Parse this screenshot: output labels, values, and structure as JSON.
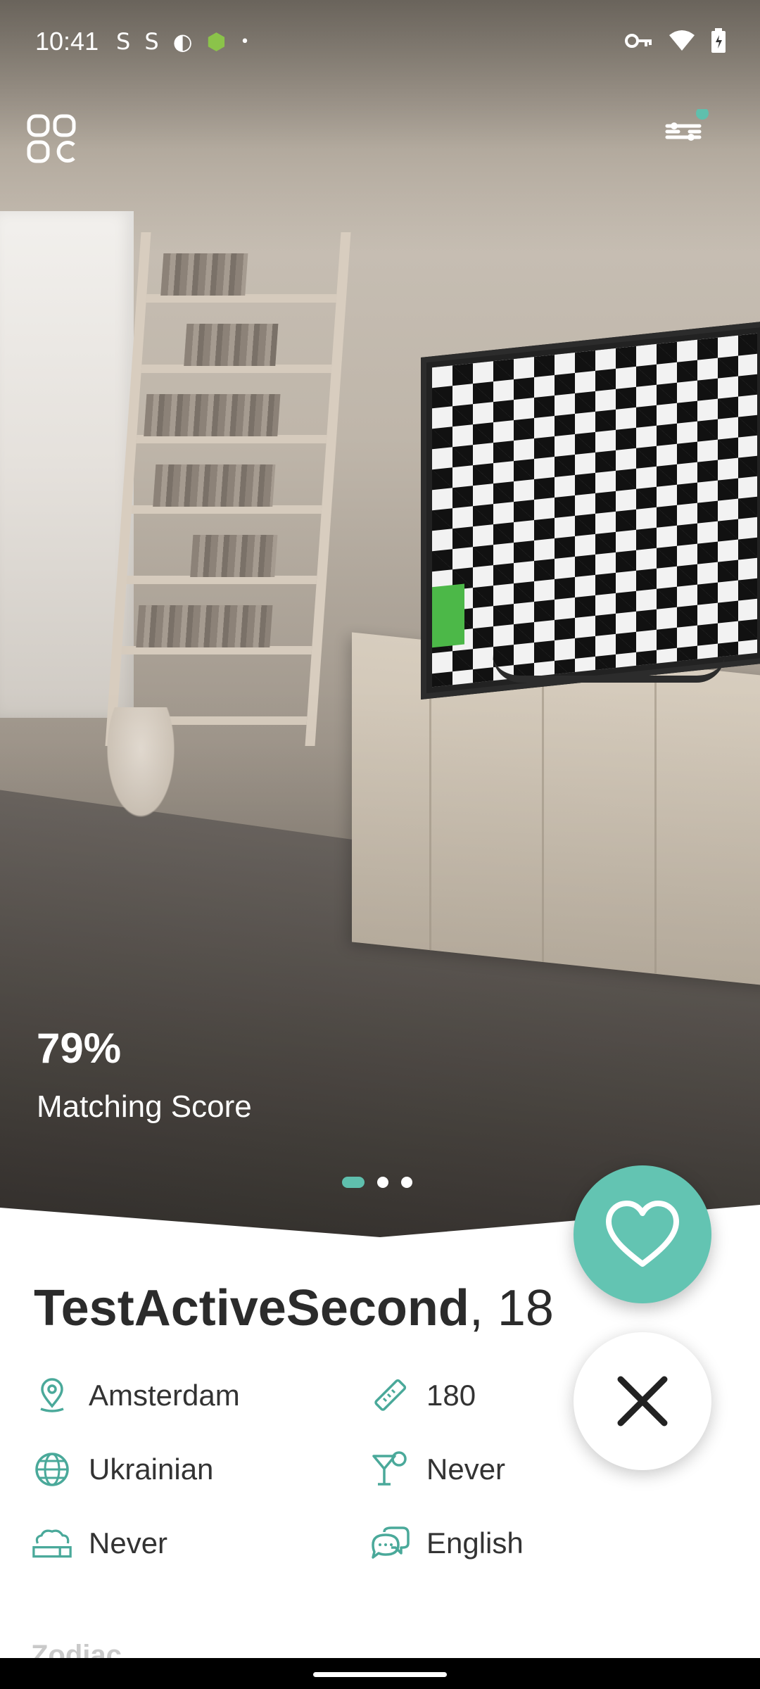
{
  "status_bar": {
    "time": "10:41",
    "left_icons": [
      "S",
      "S",
      "◐",
      "⬢",
      "•"
    ],
    "right_icons": [
      "key-icon",
      "wifi-icon",
      "battery-icon"
    ]
  },
  "header": {
    "menu_icon": "grid-menu-icon",
    "filter_icon": "filter-sliders-icon",
    "filter_badge_color": "#5fbfad"
  },
  "photo": {
    "score": "79%",
    "score_label": "Matching Score",
    "pager_total": 3,
    "pager_active": 0
  },
  "profile": {
    "name": "TestActiveSecond",
    "age": ", 18",
    "info": {
      "location": "Amsterdam",
      "height": "180",
      "nationality": "Ukrainian",
      "drinking": "Never",
      "smoking": "Never",
      "language": "English"
    },
    "next_section": "Zodiac"
  },
  "actions": {
    "like_icon": "heart-icon",
    "dislike_icon": "close-icon"
  },
  "colors": {
    "accent": "#5fbfad",
    "like_bg": "#63c4b2",
    "icon": "#4aa99a"
  }
}
